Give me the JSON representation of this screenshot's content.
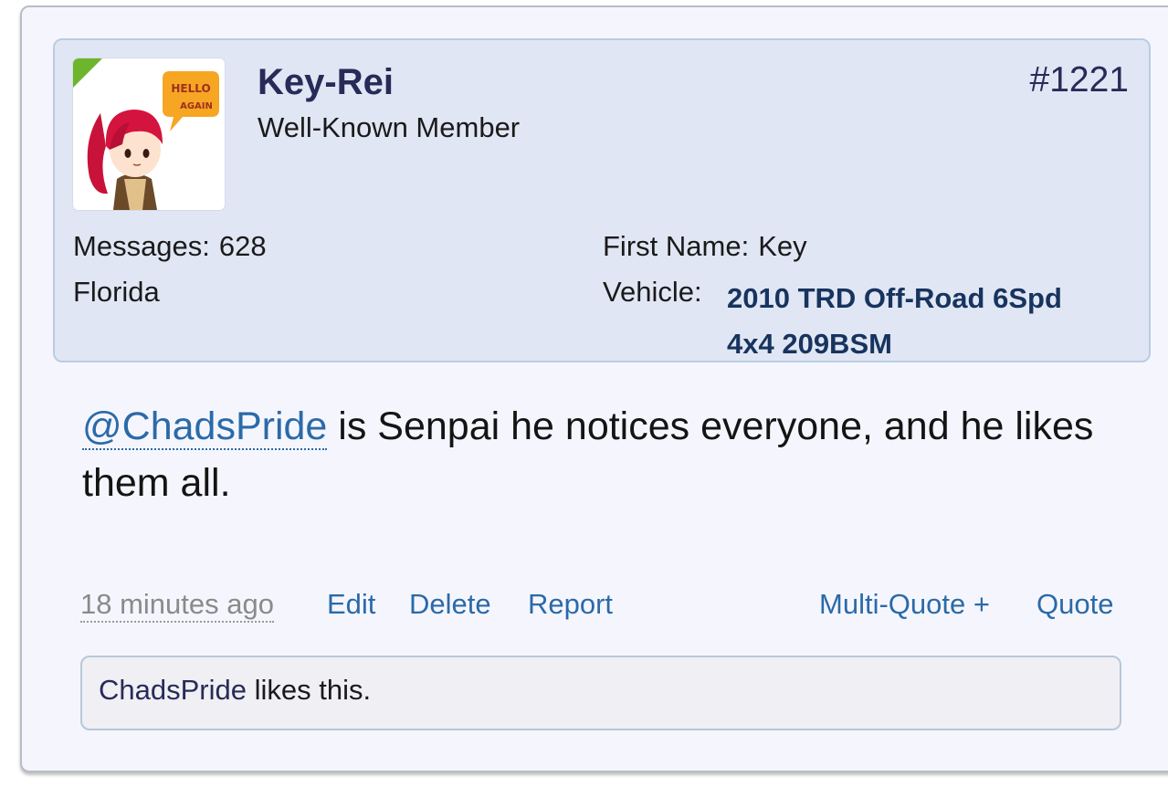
{
  "post": {
    "username": "Key-Rei",
    "user_title": "Well-Known Member",
    "post_number": "#1221",
    "avatar": {
      "speech_text_1": "HELLO",
      "speech_text_2": "AGAIN"
    },
    "stats": {
      "messages_label": "Messages:",
      "messages_value": "628",
      "location": "Florida",
      "first_name_label": "First Name:",
      "first_name_value": "Key",
      "vehicle_label": "Vehicle:",
      "vehicle_value": "2010 TRD Off-Road 6Spd 4x4 209BSM"
    },
    "message": {
      "mention": "@ChadsPride",
      "text": " is Senpai he notices everyone, and he likes them all."
    },
    "actions": {
      "time": "18 minutes ago",
      "edit": "Edit",
      "delete": "Delete",
      "report": "Report",
      "multi_quote": "Multi-Quote +",
      "quote": "Quote"
    },
    "likes": {
      "liker": "ChadsPride",
      "suffix": " likes this."
    }
  },
  "colors": {
    "online": "#6cb52d",
    "link": "#2b6aa8",
    "username": "#272b58",
    "vehicle": "#17345e"
  }
}
